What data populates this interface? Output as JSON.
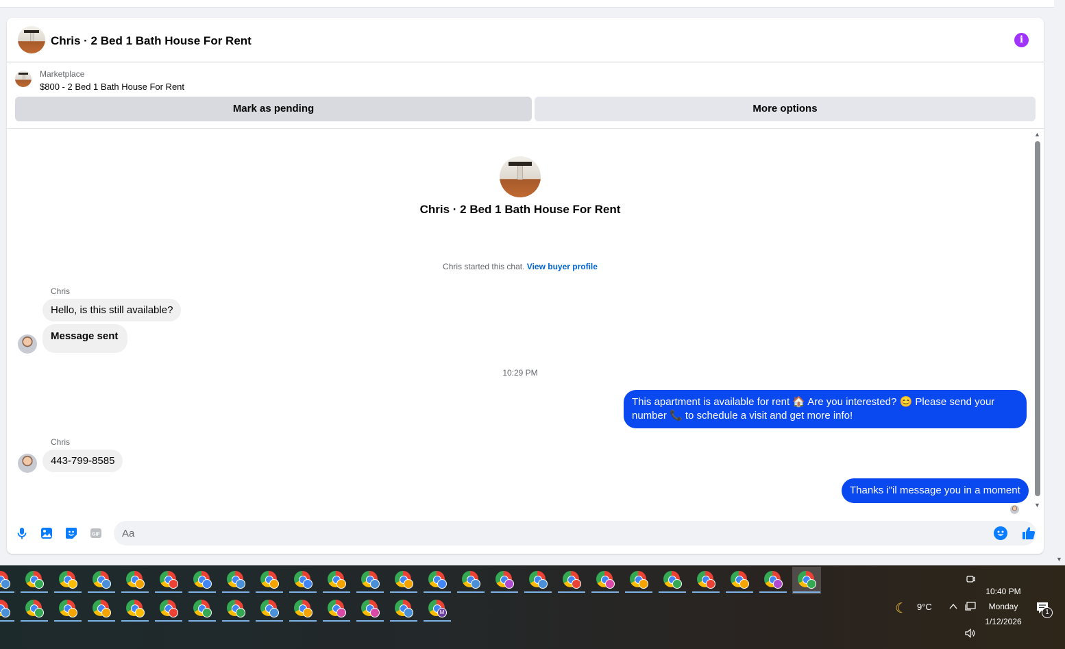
{
  "header": {
    "title": "Chris · 2 Bed 1 Bath House For Rent"
  },
  "listing": {
    "category": "Marketplace",
    "name": "$800 - 2 Bed 1 Bath House For Rent",
    "mark_pending_label": "Mark as pending",
    "more_options_label": "More options"
  },
  "chat": {
    "intro_title": "Chris · 2 Bed 1 Bath House For Rent",
    "started_text": "Chris started this chat.",
    "view_profile_link": "View buyer profile",
    "timestamp": "10:29 PM",
    "messages": [
      {
        "sender": "Chris",
        "text": "Hello, is this still available?"
      },
      {
        "text": "Message sent"
      },
      {
        "text": "This apartment is available for rent 🏠 Are you interested? 😊 Please send your number 📞 to schedule a visit and get more info!"
      },
      {
        "sender": "Chris",
        "text": "443-799-8585"
      },
      {
        "text": "Thanks i\"il message you in a moment"
      }
    ]
  },
  "composer": {
    "placeholder": "Aa"
  },
  "taskbar": {
    "weather_temp": "9°C",
    "time": "10:40 PM",
    "day": "Monday",
    "date": "1/12/2026",
    "notification_count": "1",
    "last_app_letter": "M",
    "row1_badges": [
      "#4a90d9",
      "#34a853",
      "#fbbc05",
      "#4a90d9",
      "#f4a300",
      "#ea4335",
      "#4285f4",
      "#4a90d9",
      "#f4a300",
      "#4285f4",
      "#f4a300",
      "#4a90d9",
      "#f4a300",
      "#4285f4",
      "#4a90d9",
      "#b04bd1",
      "#4a90d9",
      "#ea4335",
      "#d94aa6",
      "#f4a300",
      "#34a853",
      "#ea4335",
      "#f4a300",
      "#b04bd1",
      "#34a853"
    ],
    "row2_badges": [
      "#4a90d9",
      "#34a853",
      "#f4a300",
      "#f4a300",
      "#fbbc05",
      "#ea4335",
      "#34a853",
      "#34a853",
      "#4a90d9",
      "#f4a300",
      "#d94aa6",
      "#d94aa6",
      "#4a90d9"
    ],
    "accent": "#0a48f0"
  }
}
